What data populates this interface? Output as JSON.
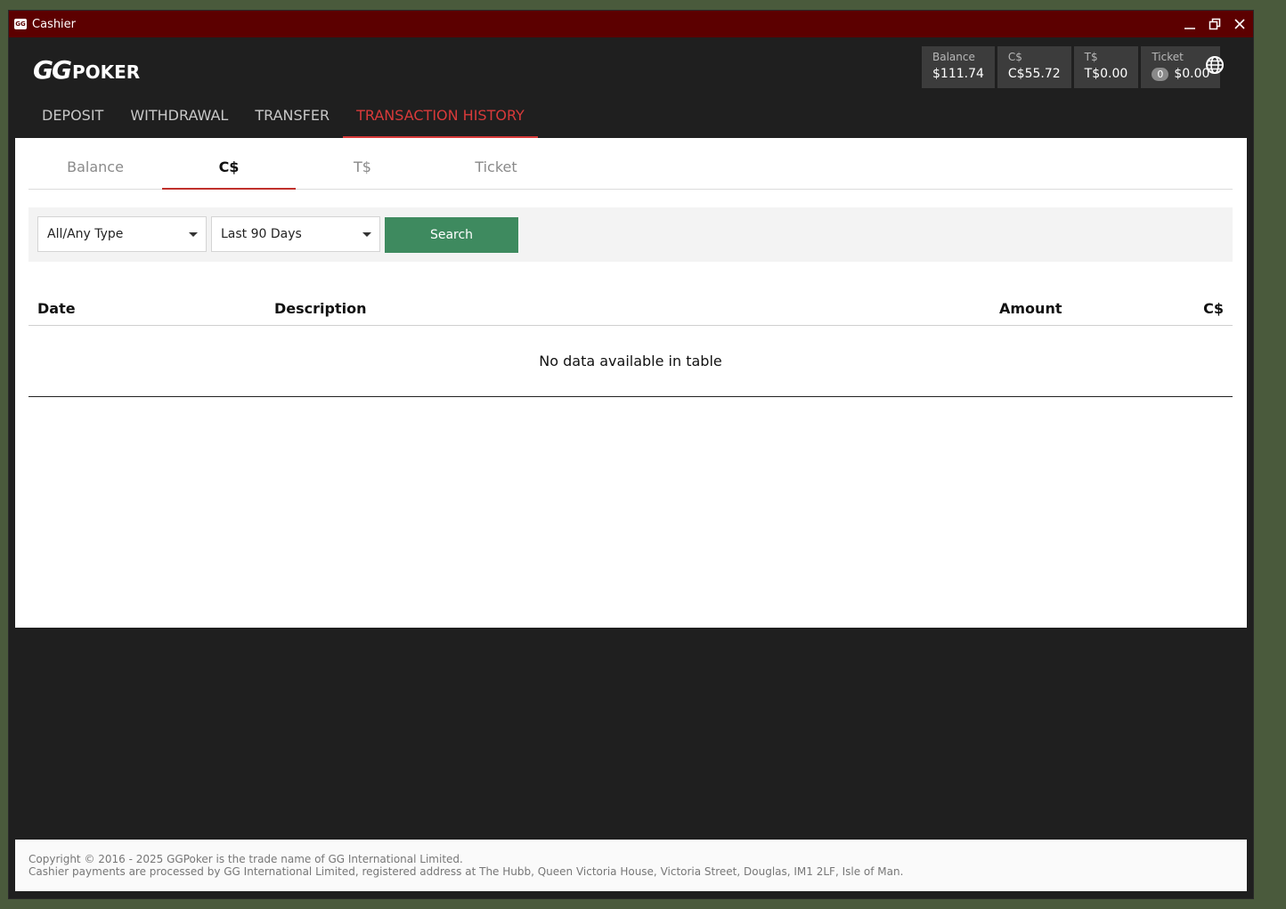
{
  "window": {
    "app_icon_text": "GG",
    "title": "Cashier"
  },
  "logo": {
    "gg": "GG",
    "poker": "POKER"
  },
  "balances": [
    {
      "label": "Balance",
      "value": "$111.74"
    },
    {
      "label": "C$",
      "value": "C$55.72"
    },
    {
      "label": "T$",
      "value": "T$0.00"
    },
    {
      "label": "Ticket",
      "count": "0",
      "value": "$0.00"
    }
  ],
  "nav": {
    "items": [
      "DEPOSIT",
      "WITHDRAWAL",
      "TRANSFER",
      "TRANSACTION HISTORY"
    ],
    "active": "TRANSACTION HISTORY"
  },
  "subtabs": {
    "items": [
      "Balance",
      "C$",
      "T$",
      "Ticket"
    ],
    "active": "C$"
  },
  "filters": {
    "type_value": "All/Any Type",
    "period_value": "Last 90 Days",
    "search_label": "Search"
  },
  "table": {
    "headers": {
      "date": "Date",
      "description": "Description",
      "amount": "Amount",
      "currency": "C$"
    },
    "empty_message": "No data available in table"
  },
  "footer": {
    "line1": "Copyright © 2016 - 2025 GGPoker is the trade name of GG International Limited.",
    "line2": "Cashier payments are processed by GG International Limited, registered address at The Hubb, Queen Victoria House, Victoria Street, Douglas, IM1 2LF, Isle of Man."
  },
  "colors": {
    "titlebar": "#5c0000",
    "accent_red": "#d83a3a",
    "search_green": "#3e8a5f",
    "dark_bg": "#1f1f1f"
  }
}
